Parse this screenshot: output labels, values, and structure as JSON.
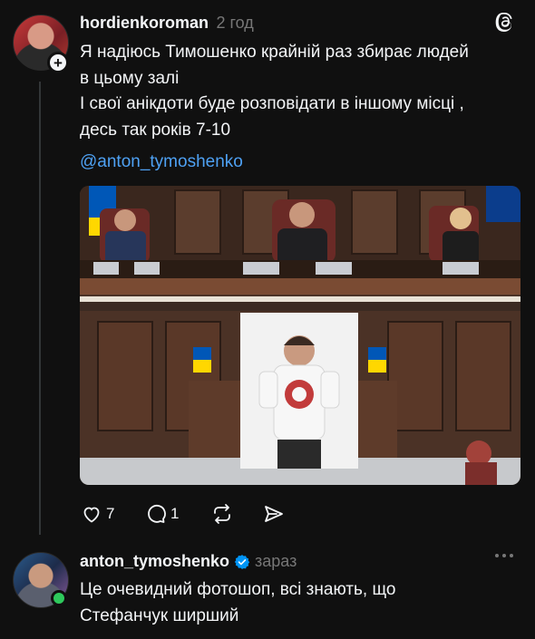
{
  "post": {
    "username": "hordienkoroman",
    "time": "2 год",
    "text_lines": [
      "Я надіюсь Тимошенко крайній раз збирає людей",
      "в цьому залі",
      "І свої анікдоти буде розповідати в іншому місці ,",
      "десь так років 7-10"
    ],
    "mention": "@anton_tymoshenko",
    "likes": "7",
    "replies": "1"
  },
  "reply": {
    "username": "anton_tymoshenko",
    "time": "зараз",
    "text_lines": [
      "Це очевидний фотошоп, всі знають, що",
      "Стефанчук ширший"
    ]
  },
  "icons": {
    "logo": "threads-logo-icon",
    "follow": "plus-icon",
    "like": "heart-icon",
    "comment": "comment-icon",
    "repost": "repost-icon",
    "share": "share-icon",
    "verified": "verified-badge-icon",
    "more": "more-icon"
  },
  "colors": {
    "background": "#101010",
    "text": "#f3f5f7",
    "muted": "#777777",
    "link": "#4ea1f3",
    "verified": "#0095f6",
    "online": "#2ec95c"
  }
}
